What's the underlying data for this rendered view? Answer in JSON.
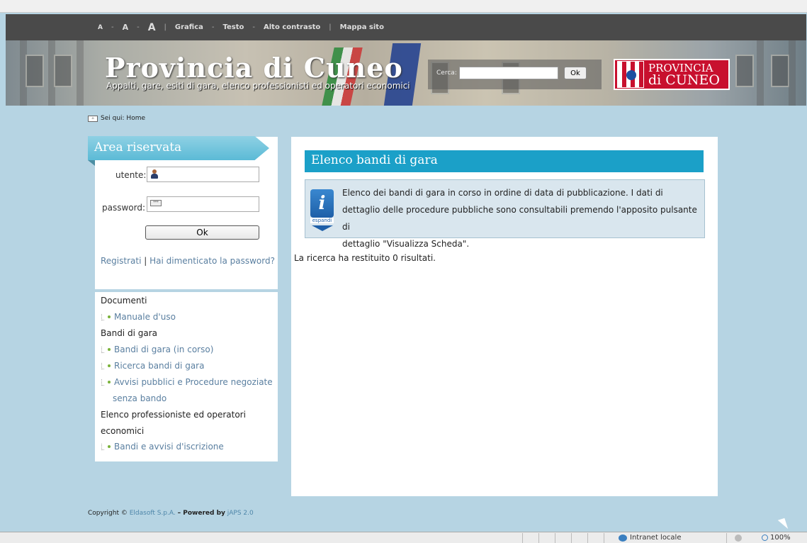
{
  "accessibility_bar": {
    "font_small": "A",
    "sep1": "-",
    "font_medium": "A",
    "sep2": "-",
    "font_large": "A",
    "pipe1": "|",
    "grafica": "Grafica",
    "sep3": "-",
    "testo": "Testo",
    "sep4": "-",
    "alto_contrasto": "Alto contrasto",
    "pipe2": "|",
    "mappa_sito": "Mappa sito"
  },
  "header": {
    "title": "Provincia di Cuneo",
    "subtitle": "Appalti, gare, esiti di gara, elenco professionisti ed operatori economici",
    "search": {
      "label": "Cerca:",
      "value": "",
      "button": "Ok"
    },
    "logo": {
      "line1": "PROVINCIA",
      "line2": "di CUNEO"
    }
  },
  "breadcrumb": {
    "icon": "home-icon",
    "text": "Sei qui: Home"
  },
  "login": {
    "title": "Area riservata",
    "username_label": "utente:",
    "username_value": "",
    "password_label": "password:",
    "password_value": "",
    "ok_button": "Ok",
    "register_link": "Registrati",
    "separator": "|",
    "forgot_link": "Hai dimenticato la password?"
  },
  "menu": {
    "sections": [
      {
        "title": "Documenti",
        "links": [
          "Manuale d'uso"
        ]
      },
      {
        "title": "Bandi di gara",
        "links": [
          "Bandi di gara (in corso)",
          "Ricerca bandi di gara",
          "Avvisi pubblici e Procedure negoziate",
          "senza bando"
        ]
      },
      {
        "title_line1": "Elenco professioniste ed operatori",
        "title_line2": "economici",
        "links": [
          "Bandi e avvisi d'iscrizione"
        ]
      }
    ]
  },
  "content": {
    "title": "Elenco bandi di gara",
    "info_icon": "info-icon",
    "info_expand": "espandi",
    "info_line1": "Elenco dei bandi di gara in corso in ordine di data di pubblicazione. I dati di",
    "info_line2": "dettaglio delle procedure pubbliche sono consultabili premendo l'apposito pulsante di",
    "info_line3": "dettaglio \"Visualizza Scheda\".",
    "result": "La ricerca ha restituito 0 risultati."
  },
  "footer": {
    "copyright": "Copyright ©",
    "company": "Eldasoft S.p.A.",
    "powered": "– Powered by",
    "product": "jAPS 2.0"
  },
  "statusbar": {
    "zone": "Intranet locale",
    "zoom": "100%"
  }
}
